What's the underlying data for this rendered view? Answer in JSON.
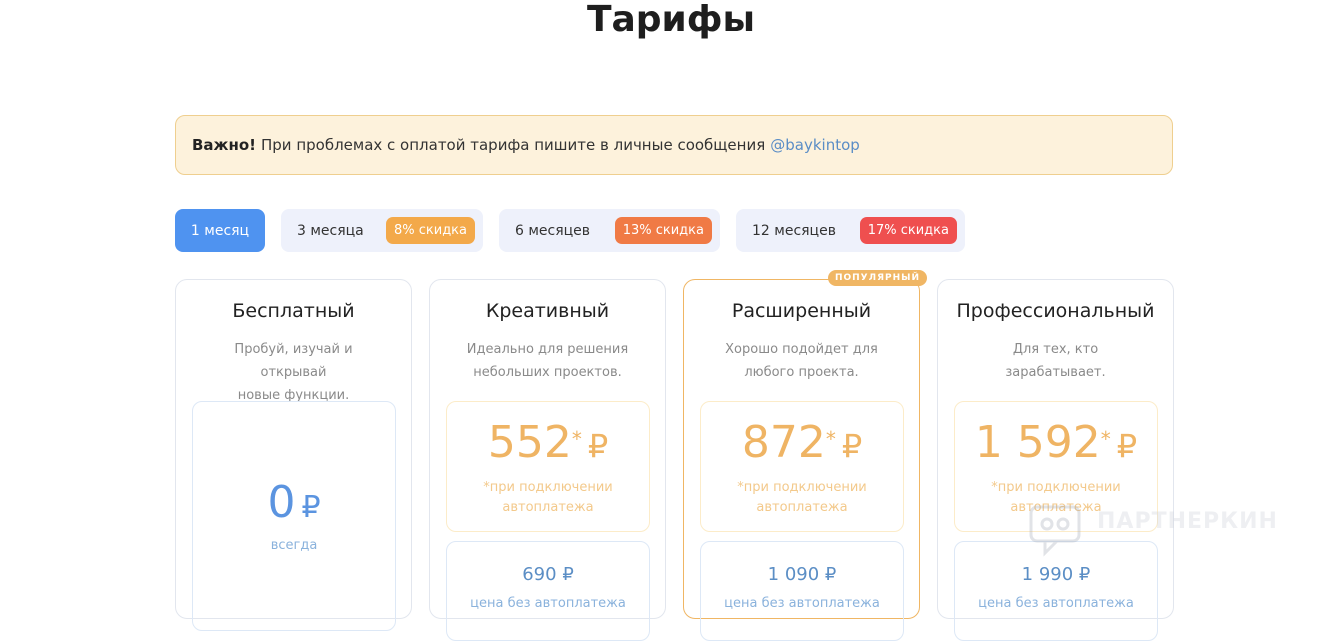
{
  "title": "Тарифы",
  "notice": {
    "bold": "Важно!",
    "text": "При проблемах с оплатой тарифа пишите в личные сообщения",
    "link": "@baykintop"
  },
  "periods": [
    {
      "label": "1 месяц",
      "active": true
    },
    {
      "label": "3 месяца",
      "discount": "8% скидка",
      "color": "#f3a94a"
    },
    {
      "label": "6 месяцев",
      "discount": "13% скидка",
      "color": "#f07a45"
    },
    {
      "label": "12 месяцев",
      "discount": "17% скидка",
      "color": "#ef4f4f"
    }
  ],
  "plans": [
    {
      "name": "Бесплатный",
      "desc1": "Пробуй, изучай и открывай",
      "desc2": "новые функции.",
      "price": "0",
      "currency": "₽",
      "price_note": "всегда"
    },
    {
      "name": "Креативный",
      "desc1": "Идеально для решения",
      "desc2": "небольших проектов.",
      "price": "552",
      "asterisk": "*",
      "currency": "₽",
      "note1": "*при подключении",
      "note2": "автоплатежа",
      "standard_price": "690 ₽",
      "standard_label": "цена без автоплатежа"
    },
    {
      "name": "Расширенный",
      "desc1": "Хорошо подойдет для",
      "desc2": "любого проекта.",
      "popular_badge": "ПОПУЛЯРНЫЙ",
      "price": "872",
      "asterisk": "*",
      "currency": "₽",
      "note1": "*при подключении",
      "note2": "автоплатежа",
      "standard_price": "1 090 ₽",
      "standard_label": "цена без автоплатежа"
    },
    {
      "name": "Профессиональный",
      "desc1": "Для тех, кто",
      "desc2": "зарабатывает.",
      "price": "1 592",
      "asterisk": "*",
      "currency": "₽",
      "note1": "*при подключении",
      "note2": "автоплатежа",
      "standard_price": "1 990 ₽",
      "standard_label": "цена без автоплатежа"
    }
  ],
  "watermark": "ПАРТНЕРКИН"
}
